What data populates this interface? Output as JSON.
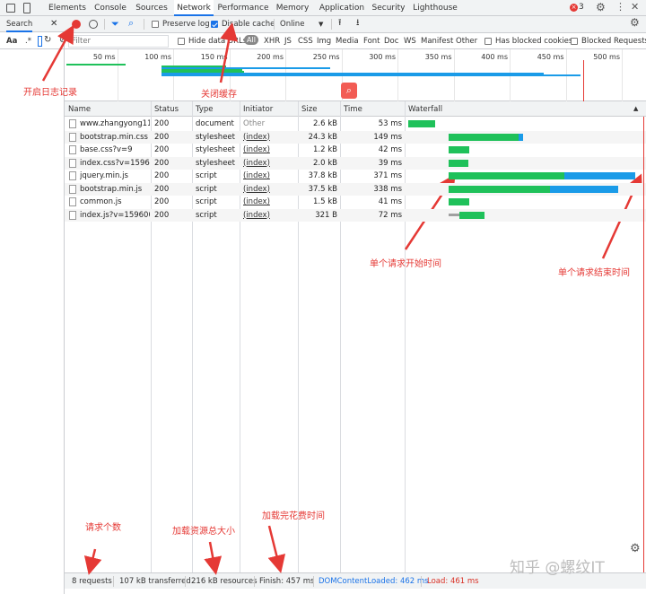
{
  "tabs": [
    "Elements",
    "Console",
    "Sources",
    "Network",
    "Performance",
    "Memory",
    "Application",
    "Security",
    "Lighthouse"
  ],
  "active_tab": "Network",
  "error_count": "3",
  "search": {
    "label": "Search"
  },
  "left_aa": {
    "aa": "Aa",
    "regex": ".*"
  },
  "toolbar": {
    "preserve_log": "Preserve log",
    "disable_cache": "Disable cache",
    "throttle": "Online"
  },
  "filter_bar": {
    "placeholder": "Filter",
    "hide_data_urls": "Hide data URLs",
    "types": [
      "All",
      "XHR",
      "JS",
      "CSS",
      "Img",
      "Media",
      "Font",
      "Doc",
      "WS",
      "Manifest",
      "Other"
    ],
    "has_blocked_cookies": "Has blocked cookies",
    "blocked_requests": "Blocked Requests"
  },
  "overview_ticks": [
    "50 ms",
    "100 ms",
    "150 ms",
    "200 ms",
    "250 ms",
    "300 ms",
    "350 ms",
    "400 ms",
    "450 ms",
    "500 ms"
  ],
  "columns": [
    "Name",
    "Status",
    "Type",
    "Initiator",
    "Size",
    "Time",
    "Waterfall"
  ],
  "requests": [
    {
      "name": "www.zhangyong11...",
      "status": "200",
      "type": "document",
      "initiator": "Other",
      "size": "2.6 kB",
      "time": "53 ms",
      "start": 0,
      "end": 53
    },
    {
      "name": "bootstrap.min.css",
      "status": "200",
      "type": "stylesheet",
      "initiator": "(index)",
      "size": "24.3 kB",
      "time": "149 ms",
      "start": 80,
      "end": 229
    },
    {
      "name": "base.css?v=9",
      "status": "200",
      "type": "stylesheet",
      "initiator": "(index)",
      "size": "1.2 kB",
      "time": "42 ms",
      "start": 80,
      "end": 122
    },
    {
      "name": "index.css?v=15960...",
      "status": "200",
      "type": "stylesheet",
      "initiator": "(index)",
      "size": "2.0 kB",
      "time": "39 ms",
      "start": 80,
      "end": 119
    },
    {
      "name": "jquery.min.js",
      "status": "200",
      "type": "script",
      "initiator": "(index)",
      "size": "37.8 kB",
      "time": "371 ms",
      "start": 80,
      "end": 451
    },
    {
      "name": "bootstrap.min.js",
      "status": "200",
      "type": "script",
      "initiator": "(index)",
      "size": "37.5 kB",
      "time": "338 ms",
      "start": 80,
      "end": 418
    },
    {
      "name": "common.js",
      "status": "200",
      "type": "script",
      "initiator": "(index)",
      "size": "1.5 kB",
      "time": "41 ms",
      "start": 80,
      "end": 121
    },
    {
      "name": "index.js?v=159600...",
      "status": "200",
      "type": "script",
      "initiator": "(index)",
      "size": "321 B",
      "time": "72 ms",
      "start": 80,
      "end": 152
    }
  ],
  "statusbar": {
    "requests": "8 requests",
    "transferred": "107 kB transferred",
    "resources": "216 kB resources",
    "finish": "Finish: 457 ms",
    "dom": "DOMContentLoaded: 462 ms",
    "load": "Load: 461 ms"
  },
  "annotations": {
    "record": "开启日志记录",
    "cache": "关闭缓存",
    "start": "单个请求开始时间",
    "end": "单个请求结束时间",
    "count": "请求个数",
    "size": "加载资源总大小",
    "time": "加载完花费时间"
  },
  "watermark": "知乎 @螺纹IT",
  "colors": {
    "green": "#1fc15a",
    "blue": "#1a9be8",
    "gray": "#a0a0a0",
    "red": "#e53935",
    "accent": "#1a73e8"
  }
}
